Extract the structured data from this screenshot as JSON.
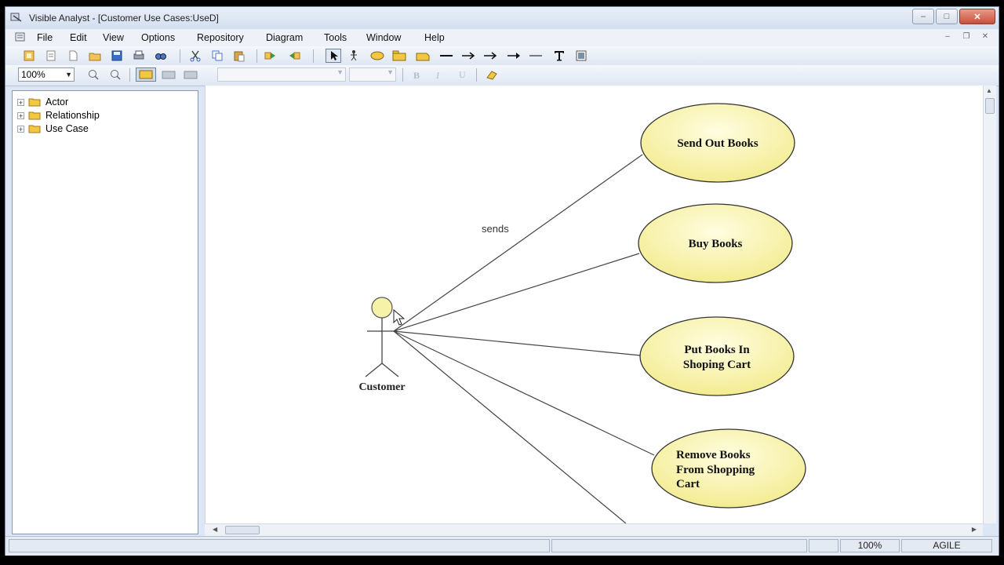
{
  "window": {
    "title": "Visible Analyst - [Customer Use Cases:UseD]",
    "buttons": {
      "minimize": "–",
      "maximize": "□",
      "close": "✕"
    }
  },
  "menu": {
    "items": [
      "File",
      "Edit",
      "View",
      "Options",
      "Repository",
      "Diagram",
      "Tools",
      "Window",
      "Help"
    ],
    "mdi_buttons": {
      "minimize": "–",
      "restore": "❐",
      "close": "✕"
    }
  },
  "toolbar": {
    "zoom_value": "100%"
  },
  "tree": {
    "items": [
      {
        "label": "Actor",
        "expander": "+"
      },
      {
        "label": "Relationship",
        "expander": "+"
      },
      {
        "label": "Use Case",
        "expander": "+"
      }
    ]
  },
  "diagram": {
    "actor": {
      "name": "Customer"
    },
    "use_cases": [
      {
        "lines": [
          "Send Out Books"
        ]
      },
      {
        "lines": [
          "Buy Books"
        ]
      },
      {
        "lines": [
          "Put Books In",
          "Shoping Cart"
        ]
      },
      {
        "lines": [
          "Remove Books",
          "From Shopping",
          "Cart"
        ]
      }
    ],
    "relationship_label": "sends",
    "colors": {
      "use_case_fill": "#fbf5b4",
      "use_case_stroke": "#333333",
      "actor_head_fill": "#f6f3a8"
    }
  },
  "statusbar": {
    "zoom": "100%",
    "mode": "AGILE"
  }
}
